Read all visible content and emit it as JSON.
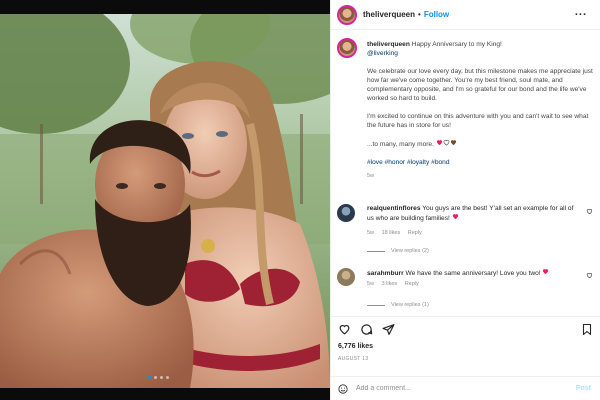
{
  "post": {
    "username": "theliverqueen",
    "separator": "•",
    "follow_label": "Follow",
    "more_label": "...",
    "caption_username": "theliverqueen",
    "caption_line1": "Happy Anniversary to my King!",
    "caption_mention": "@liverking",
    "caption_p1": "We celebrate our love every day, but this milestone makes me appreciate just how far we've come together. You're my best friend, soul mate, and complementary opposite, and I'm so grateful for our bond and the life we've worked so hard to build.",
    "caption_p2": "I'm excited to continue on this adventure with you and can't wait to see what the future has in store for us!",
    "caption_p3": "...to many, many more.",
    "caption_hashtags": "#love #honor #loyalty #bond",
    "caption_time": "5w",
    "likes": "6,776 likes",
    "date": "AUGUST 13",
    "photo_description_icons": [
      "carousel-dots"
    ]
  },
  "comments": [
    {
      "username": "realquentinflores",
      "text": "You guys are the best! Y'all set an example for all of us who are building families!",
      "time": "5w",
      "likes": "18 likes",
      "reply_label": "Reply",
      "view_replies": "View replies (2)"
    },
    {
      "username": "sarahmburr",
      "text": "We have the same anniversary! Love you two!",
      "time": "5w",
      "likes": "3 likes",
      "reply_label": "Reply",
      "view_replies": "View replies (1)"
    }
  ],
  "add_comment": {
    "placeholder": "Add a comment...",
    "post_label": "Post"
  },
  "colors": {
    "accent": "#0095f6",
    "heart": "#ed4956",
    "link": "#00376b"
  },
  "icons": [
    "heart-icon",
    "comment-icon",
    "share-icon",
    "bookmark-icon",
    "emoji-icon",
    "more-icon"
  ]
}
